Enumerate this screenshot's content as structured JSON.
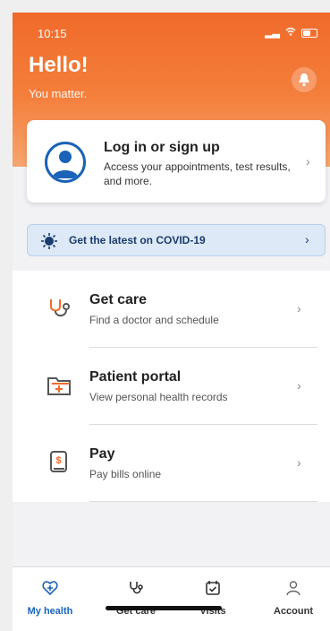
{
  "status_bar": {
    "time": "10:15"
  },
  "header": {
    "greeting": "Hello!",
    "tagline": "You matter."
  },
  "login_card": {
    "title": "Log in or sign up",
    "subtitle": "Access your appointments, test results, and more."
  },
  "banner": {
    "text": "Get the latest on COVID-19"
  },
  "menu": [
    {
      "title": "Get care",
      "subtitle": "Find a doctor and schedule",
      "icon": "stethoscope-icon"
    },
    {
      "title": "Patient portal",
      "subtitle": "View personal health records",
      "icon": "folder-plus-icon"
    },
    {
      "title": "Pay",
      "subtitle": "Pay bills online",
      "icon": "bill-icon"
    }
  ],
  "tabs": [
    {
      "label": "My health",
      "icon": "heart-plus-icon",
      "active": true
    },
    {
      "label": "Get care",
      "icon": "stethoscope-icon",
      "active": false
    },
    {
      "label": "Visits",
      "icon": "calendar-check-icon",
      "active": false
    },
    {
      "label": "Account",
      "icon": "person-icon",
      "active": false
    }
  ],
  "colors": {
    "accent": "#f06a2a",
    "primary_blue": "#1a63b8"
  }
}
